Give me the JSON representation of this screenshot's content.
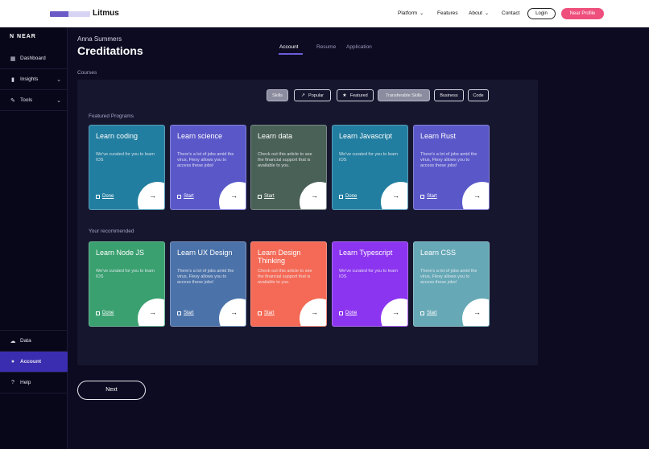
{
  "topbar": {
    "logo_text": "Litmus",
    "nav": [
      {
        "label": "Platform",
        "has_chevron": true
      },
      {
        "label": "Features",
        "has_chevron": false
      },
      {
        "label": "About",
        "has_chevron": true
      },
      {
        "label": "Contact",
        "has_chevron": false
      }
    ],
    "login_label": "Login",
    "profile_label": "Near Profile"
  },
  "sidebar": {
    "logo_text": "NEAR",
    "items": [
      {
        "label": "Dashboard",
        "icon": "grid-icon"
      },
      {
        "label": "Insights",
        "icon": "bar-chart-icon"
      },
      {
        "label": "Tools",
        "icon": "wrench-icon"
      }
    ],
    "bottom_items": [
      {
        "label": "Data",
        "icon": "cloud-icon"
      },
      {
        "label": "Account",
        "icon": "user-icon"
      },
      {
        "label": "Help",
        "icon": "help-icon"
      }
    ]
  },
  "header": {
    "user_name": "Anna Summers",
    "title": "Creditations"
  },
  "tabs": [
    "Account",
    "Resume",
    "Application"
  ],
  "courses_label": "Courses",
  "filters": [
    "Skills",
    "Popular",
    "Featured",
    "Transferable Skills",
    "Business",
    "Code"
  ],
  "featured": {
    "label": "Featured Programs",
    "cards": [
      {
        "title": "Learn coding",
        "desc": "We've curated for you to learn IOS",
        "cta": "Done",
        "color": "#227ea0"
      },
      {
        "title": "Learn science",
        "desc": "There's a lot of jobs amid the virus, Flexy allows you to access these jobs!",
        "cta": "Start",
        "color": "#5a58c9"
      },
      {
        "title": "Learn data",
        "desc": "Check out this article to see the financial support that is available to you.",
        "cta": "Start",
        "color": "#4a6158"
      },
      {
        "title": "Learn Javascript",
        "desc": "We've curated for you to learn IOS",
        "cta": "Done",
        "color": "#227ea0"
      },
      {
        "title": "Learn Rust",
        "desc": "There's a lot of jobs amid the virus, Flexy allows you to access these jobs!",
        "cta": "Start",
        "color": "#5a58c9"
      }
    ]
  },
  "recommended": {
    "label": "Your recommended",
    "cards": [
      {
        "title": "Learn Node JS",
        "desc": "We've curated for you to learn IOS",
        "cta": "Done",
        "color": "#3aa070"
      },
      {
        "title": "Learn UX Design",
        "desc": "There's a lot of jobs amid the virus, Flexy allows you to access these jobs!",
        "cta": "Start",
        "color": "#4b72a9"
      },
      {
        "title": "Learn Design Thinking",
        "desc": "Check out this article to see the financial support that is available to you.",
        "cta": "Start",
        "color": "#f46a56"
      },
      {
        "title": "Learn Typescript",
        "desc": "We've curated for you to learn IOS",
        "cta": "Done",
        "color": "#8c35f0"
      },
      {
        "title": "Learn CSS",
        "desc": "There's a lot of jobs amid the virus, Flexy allows you to access these jobs!",
        "cta": "Start",
        "color": "#66a8b6"
      }
    ]
  },
  "next_label": "Next"
}
